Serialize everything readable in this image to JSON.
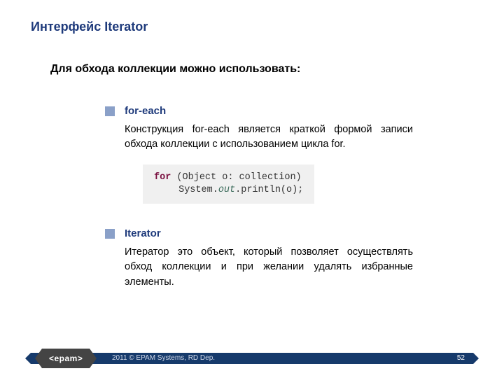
{
  "title": "Интерфейс Iterator",
  "subtitle": "Для обхода коллекции можно использовать:",
  "bullets": [
    {
      "label": "for-each",
      "body": "Конструкция for-each является краткой формой записи обхода коллекции с использованием цикла for."
    },
    {
      "label": "Iterator",
      "body": "Итератор это объект, который позволяет осуществлять обход коллекции и при желании удалять избранные элементы."
    }
  ],
  "code": {
    "keyword": "for",
    "line1_rest": " (Object o: collection)",
    "line2_pre": "System.",
    "line2_field": "out",
    "line2_post": ".println(o);"
  },
  "footer": {
    "logo": "<epam>",
    "copyright": "2011 © EPAM Systems, RD Dep.",
    "page": "52"
  }
}
